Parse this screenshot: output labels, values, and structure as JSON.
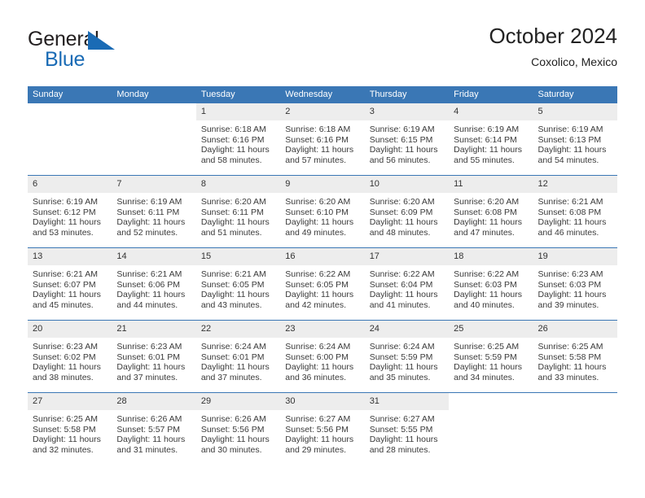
{
  "brand": {
    "name_part1": "General",
    "name_part2": "Blue",
    "mark": "triangle-flag-logo",
    "color_dark": "#231f20",
    "color_blue": "#1a6bb5"
  },
  "header": {
    "title": "October 2024",
    "subtitle": "Coxolico, Mexico"
  },
  "theme": {
    "header_blue": "#3a77b5",
    "daynum_band": "#ededed",
    "text": "#3a3a3a"
  },
  "weekday_headers": [
    "Sunday",
    "Monday",
    "Tuesday",
    "Wednesday",
    "Thursday",
    "Friday",
    "Saturday"
  ],
  "weeks": [
    [
      {
        "day": "",
        "sunrise": "",
        "sunset": "",
        "daylight1": "",
        "daylight2": ""
      },
      {
        "day": "",
        "sunrise": "",
        "sunset": "",
        "daylight1": "",
        "daylight2": ""
      },
      {
        "day": "1",
        "sunrise": "Sunrise: 6:18 AM",
        "sunset": "Sunset: 6:16 PM",
        "daylight1": "Daylight: 11 hours",
        "daylight2": "and 58 minutes."
      },
      {
        "day": "2",
        "sunrise": "Sunrise: 6:18 AM",
        "sunset": "Sunset: 6:16 PM",
        "daylight1": "Daylight: 11 hours",
        "daylight2": "and 57 minutes."
      },
      {
        "day": "3",
        "sunrise": "Sunrise: 6:19 AM",
        "sunset": "Sunset: 6:15 PM",
        "daylight1": "Daylight: 11 hours",
        "daylight2": "and 56 minutes."
      },
      {
        "day": "4",
        "sunrise": "Sunrise: 6:19 AM",
        "sunset": "Sunset: 6:14 PM",
        "daylight1": "Daylight: 11 hours",
        "daylight2": "and 55 minutes."
      },
      {
        "day": "5",
        "sunrise": "Sunrise: 6:19 AM",
        "sunset": "Sunset: 6:13 PM",
        "daylight1": "Daylight: 11 hours",
        "daylight2": "and 54 minutes."
      }
    ],
    [
      {
        "day": "6",
        "sunrise": "Sunrise: 6:19 AM",
        "sunset": "Sunset: 6:12 PM",
        "daylight1": "Daylight: 11 hours",
        "daylight2": "and 53 minutes."
      },
      {
        "day": "7",
        "sunrise": "Sunrise: 6:19 AM",
        "sunset": "Sunset: 6:11 PM",
        "daylight1": "Daylight: 11 hours",
        "daylight2": "and 52 minutes."
      },
      {
        "day": "8",
        "sunrise": "Sunrise: 6:20 AM",
        "sunset": "Sunset: 6:11 PM",
        "daylight1": "Daylight: 11 hours",
        "daylight2": "and 51 minutes."
      },
      {
        "day": "9",
        "sunrise": "Sunrise: 6:20 AM",
        "sunset": "Sunset: 6:10 PM",
        "daylight1": "Daylight: 11 hours",
        "daylight2": "and 49 minutes."
      },
      {
        "day": "10",
        "sunrise": "Sunrise: 6:20 AM",
        "sunset": "Sunset: 6:09 PM",
        "daylight1": "Daylight: 11 hours",
        "daylight2": "and 48 minutes."
      },
      {
        "day": "11",
        "sunrise": "Sunrise: 6:20 AM",
        "sunset": "Sunset: 6:08 PM",
        "daylight1": "Daylight: 11 hours",
        "daylight2": "and 47 minutes."
      },
      {
        "day": "12",
        "sunrise": "Sunrise: 6:21 AM",
        "sunset": "Sunset: 6:08 PM",
        "daylight1": "Daylight: 11 hours",
        "daylight2": "and 46 minutes."
      }
    ],
    [
      {
        "day": "13",
        "sunrise": "Sunrise: 6:21 AM",
        "sunset": "Sunset: 6:07 PM",
        "daylight1": "Daylight: 11 hours",
        "daylight2": "and 45 minutes."
      },
      {
        "day": "14",
        "sunrise": "Sunrise: 6:21 AM",
        "sunset": "Sunset: 6:06 PM",
        "daylight1": "Daylight: 11 hours",
        "daylight2": "and 44 minutes."
      },
      {
        "day": "15",
        "sunrise": "Sunrise: 6:21 AM",
        "sunset": "Sunset: 6:05 PM",
        "daylight1": "Daylight: 11 hours",
        "daylight2": "and 43 minutes."
      },
      {
        "day": "16",
        "sunrise": "Sunrise: 6:22 AM",
        "sunset": "Sunset: 6:05 PM",
        "daylight1": "Daylight: 11 hours",
        "daylight2": "and 42 minutes."
      },
      {
        "day": "17",
        "sunrise": "Sunrise: 6:22 AM",
        "sunset": "Sunset: 6:04 PM",
        "daylight1": "Daylight: 11 hours",
        "daylight2": "and 41 minutes."
      },
      {
        "day": "18",
        "sunrise": "Sunrise: 6:22 AM",
        "sunset": "Sunset: 6:03 PM",
        "daylight1": "Daylight: 11 hours",
        "daylight2": "and 40 minutes."
      },
      {
        "day": "19",
        "sunrise": "Sunrise: 6:23 AM",
        "sunset": "Sunset: 6:03 PM",
        "daylight1": "Daylight: 11 hours",
        "daylight2": "and 39 minutes."
      }
    ],
    [
      {
        "day": "20",
        "sunrise": "Sunrise: 6:23 AM",
        "sunset": "Sunset: 6:02 PM",
        "daylight1": "Daylight: 11 hours",
        "daylight2": "and 38 minutes."
      },
      {
        "day": "21",
        "sunrise": "Sunrise: 6:23 AM",
        "sunset": "Sunset: 6:01 PM",
        "daylight1": "Daylight: 11 hours",
        "daylight2": "and 37 minutes."
      },
      {
        "day": "22",
        "sunrise": "Sunrise: 6:24 AM",
        "sunset": "Sunset: 6:01 PM",
        "daylight1": "Daylight: 11 hours",
        "daylight2": "and 37 minutes."
      },
      {
        "day": "23",
        "sunrise": "Sunrise: 6:24 AM",
        "sunset": "Sunset: 6:00 PM",
        "daylight1": "Daylight: 11 hours",
        "daylight2": "and 36 minutes."
      },
      {
        "day": "24",
        "sunrise": "Sunrise: 6:24 AM",
        "sunset": "Sunset: 5:59 PM",
        "daylight1": "Daylight: 11 hours",
        "daylight2": "and 35 minutes."
      },
      {
        "day": "25",
        "sunrise": "Sunrise: 6:25 AM",
        "sunset": "Sunset: 5:59 PM",
        "daylight1": "Daylight: 11 hours",
        "daylight2": "and 34 minutes."
      },
      {
        "day": "26",
        "sunrise": "Sunrise: 6:25 AM",
        "sunset": "Sunset: 5:58 PM",
        "daylight1": "Daylight: 11 hours",
        "daylight2": "and 33 minutes."
      }
    ],
    [
      {
        "day": "27",
        "sunrise": "Sunrise: 6:25 AM",
        "sunset": "Sunset: 5:58 PM",
        "daylight1": "Daylight: 11 hours",
        "daylight2": "and 32 minutes."
      },
      {
        "day": "28",
        "sunrise": "Sunrise: 6:26 AM",
        "sunset": "Sunset: 5:57 PM",
        "daylight1": "Daylight: 11 hours",
        "daylight2": "and 31 minutes."
      },
      {
        "day": "29",
        "sunrise": "Sunrise: 6:26 AM",
        "sunset": "Sunset: 5:56 PM",
        "daylight1": "Daylight: 11 hours",
        "daylight2": "and 30 minutes."
      },
      {
        "day": "30",
        "sunrise": "Sunrise: 6:27 AM",
        "sunset": "Sunset: 5:56 PM",
        "daylight1": "Daylight: 11 hours",
        "daylight2": "and 29 minutes."
      },
      {
        "day": "31",
        "sunrise": "Sunrise: 6:27 AM",
        "sunset": "Sunset: 5:55 PM",
        "daylight1": "Daylight: 11 hours",
        "daylight2": "and 28 minutes."
      },
      {
        "day": "",
        "sunrise": "",
        "sunset": "",
        "daylight1": "",
        "daylight2": ""
      },
      {
        "day": "",
        "sunrise": "",
        "sunset": "",
        "daylight1": "",
        "daylight2": ""
      }
    ]
  ]
}
